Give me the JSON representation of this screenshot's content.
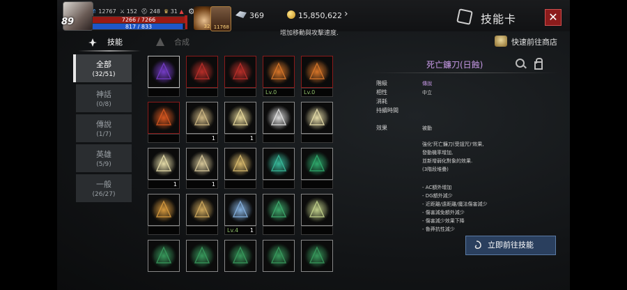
{
  "player": {
    "level": "89",
    "combat_power": "12767",
    "stat_attack": "152",
    "stat_defense": "248",
    "stat_trophy": "31",
    "hp_text": "7266 / 7266",
    "mp_text": "817 / 833",
    "hp_ratio": 1.0,
    "mp_ratio": 0.98
  },
  "quick_slots": [
    {
      "name": "potion",
      "count": "325"
    },
    {
      "name": "skill-book",
      "count": "11768"
    }
  ],
  "currency": {
    "feather_amount": "369",
    "gold_amount": "15,850,622"
  },
  "header": {
    "title": "技能卡",
    "close_symbol": "✕",
    "tooltip": "增加移動與攻擊速度."
  },
  "tabs": [
    {
      "label": "技能",
      "active": true
    },
    {
      "label": "合成",
      "active": false
    }
  ],
  "shop_link": "快速前往商店",
  "categories": [
    {
      "label": "全部",
      "count": "(32/51)",
      "active": true
    },
    {
      "label": "神話",
      "count": "(0/8)",
      "active": false
    },
    {
      "label": "傳說",
      "count": "(1/7)",
      "active": false
    },
    {
      "label": "英雄",
      "count": "(5/9)",
      "active": false
    },
    {
      "label": "一般",
      "count": "(26/27)",
      "active": false
    }
  ],
  "cards": [
    {
      "icon": "scythe-purple-icon",
      "color": "#7a3fd0",
      "border": "#bbbbbb",
      "level": "",
      "count": ""
    },
    {
      "icon": "skull-red-icon",
      "color": "#c0302a",
      "border": "#8b1a1a",
      "level": "",
      "count": ""
    },
    {
      "icon": "eye-red-icon",
      "color": "#c0302a",
      "border": "#8b1a1a",
      "level": "",
      "count": ""
    },
    {
      "icon": "spark-orange-icon",
      "color": "#e07a2a",
      "border": "#8b1a1a",
      "level": "Lv.0",
      "count": ""
    },
    {
      "icon": "figure-orange-icon",
      "color": "#e07a2a",
      "border": "#8b1a1a",
      "level": "Lv.0",
      "count": ""
    },
    {
      "icon": "blade-fire-icon",
      "color": "#e05a20",
      "border": "#8b1a1a",
      "level": "",
      "count": ""
    },
    {
      "icon": "shield-icon",
      "color": "#d8c08a",
      "border": "#888888",
      "level": "",
      "count": "1"
    },
    {
      "icon": "lightning-icon",
      "color": "#f0e0a0",
      "border": "#888888",
      "level": "",
      "count": "1"
    },
    {
      "icon": "curve-arrow-icon",
      "color": "#e8e8e8",
      "border": "#888888",
      "level": "",
      "count": ""
    },
    {
      "icon": "burst-icon",
      "color": "#f0e6b0",
      "border": "#888888",
      "level": "",
      "count": ""
    },
    {
      "icon": "pyramid-icon",
      "color": "#f0e6b0",
      "border": "#888888",
      "level": "",
      "count": "1"
    },
    {
      "icon": "eye-gold-icon",
      "color": "#e0d0a0",
      "border": "#888888",
      "level": "",
      "count": "1"
    },
    {
      "icon": "sun-gold-icon",
      "color": "#e0c070",
      "border": "#888888",
      "level": "",
      "count": ""
    },
    {
      "icon": "sword-green-icon",
      "color": "#3ac0a0",
      "border": "#888888",
      "level": "",
      "count": ""
    },
    {
      "icon": "wave-green-icon",
      "color": "#30b070",
      "border": "#888888",
      "level": "",
      "count": ""
    },
    {
      "icon": "cards-orange-icon",
      "color": "#e0a040",
      "border": "#888888",
      "level": "",
      "count": ""
    },
    {
      "icon": "scroll-gold-icon",
      "color": "#d8b060",
      "border": "#888888",
      "level": "",
      "count": ""
    },
    {
      "icon": "ghost-blue-icon",
      "color": "#8ab8e8",
      "border": "#888888",
      "level": "Lv.4",
      "count": "1"
    },
    {
      "icon": "eye-green-icon",
      "color": "#40b070",
      "border": "#888888",
      "level": "",
      "count": ""
    },
    {
      "icon": "slash-gold-icon",
      "color": "#c8d890",
      "border": "#888888",
      "level": "",
      "count": ""
    },
    {
      "icon": "skull-green-icon",
      "color": "#3aa060",
      "border": "#888888",
      "level": "",
      "count": ""
    },
    {
      "icon": "swirl-green-icon",
      "color": "#3aa060",
      "border": "#888888",
      "level": "",
      "count": ""
    },
    {
      "icon": "leaf-green-icon",
      "color": "#3aa060",
      "border": "#888888",
      "level": "",
      "count": ""
    },
    {
      "icon": "circle-green-icon",
      "color": "#3aa060",
      "border": "#888888",
      "level": "",
      "count": ""
    },
    {
      "icon": "arrows-green-icon",
      "color": "#3aa060",
      "border": "#888888",
      "level": "",
      "count": ""
    }
  ],
  "detail": {
    "name": "死亡鐮刀(日蝕)",
    "rows": [
      {
        "label": "階級",
        "value": "傳說"
      },
      {
        "label": "相性",
        "value": "中立"
      },
      {
        "label": "消耗",
        "value": ""
      },
      {
        "label": "持續時間",
        "value": ""
      },
      {
        "label": "效果",
        "value": "被動"
      }
    ],
    "description": [
      "強化'死亡鐮刀(受詛咒)'效果,",
      "發動機率增加,",
      "並新增弱化對象的效果.",
      "(3階段堆疊)",
      "",
      "- AC額外增加",
      "- DG額外減少",
      "- 近距離/遠距離/魔法傷害減少",
      "- 傷害減免額外減少",
      "- 傷害減少效果下降",
      "- 魯莽抗性減少"
    ],
    "button_label": "立即前往技能"
  }
}
